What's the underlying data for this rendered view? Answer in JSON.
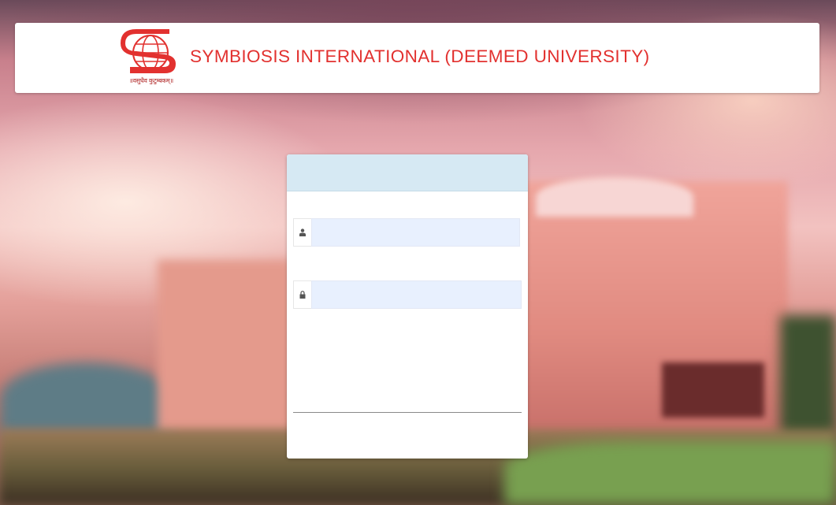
{
  "header": {
    "university_name": "SYMBIOSIS INTERNATIONAL (DEEMED UNIVERSITY)",
    "motto": "॥वसुधैव कुटुम्बकम्॥",
    "brand_color": "#e2312f"
  },
  "login": {
    "header_color": "#d6e9f3",
    "username": {
      "icon": "user-icon",
      "value": "",
      "placeholder": ""
    },
    "password": {
      "icon": "lock-icon",
      "value": "",
      "placeholder": ""
    }
  }
}
